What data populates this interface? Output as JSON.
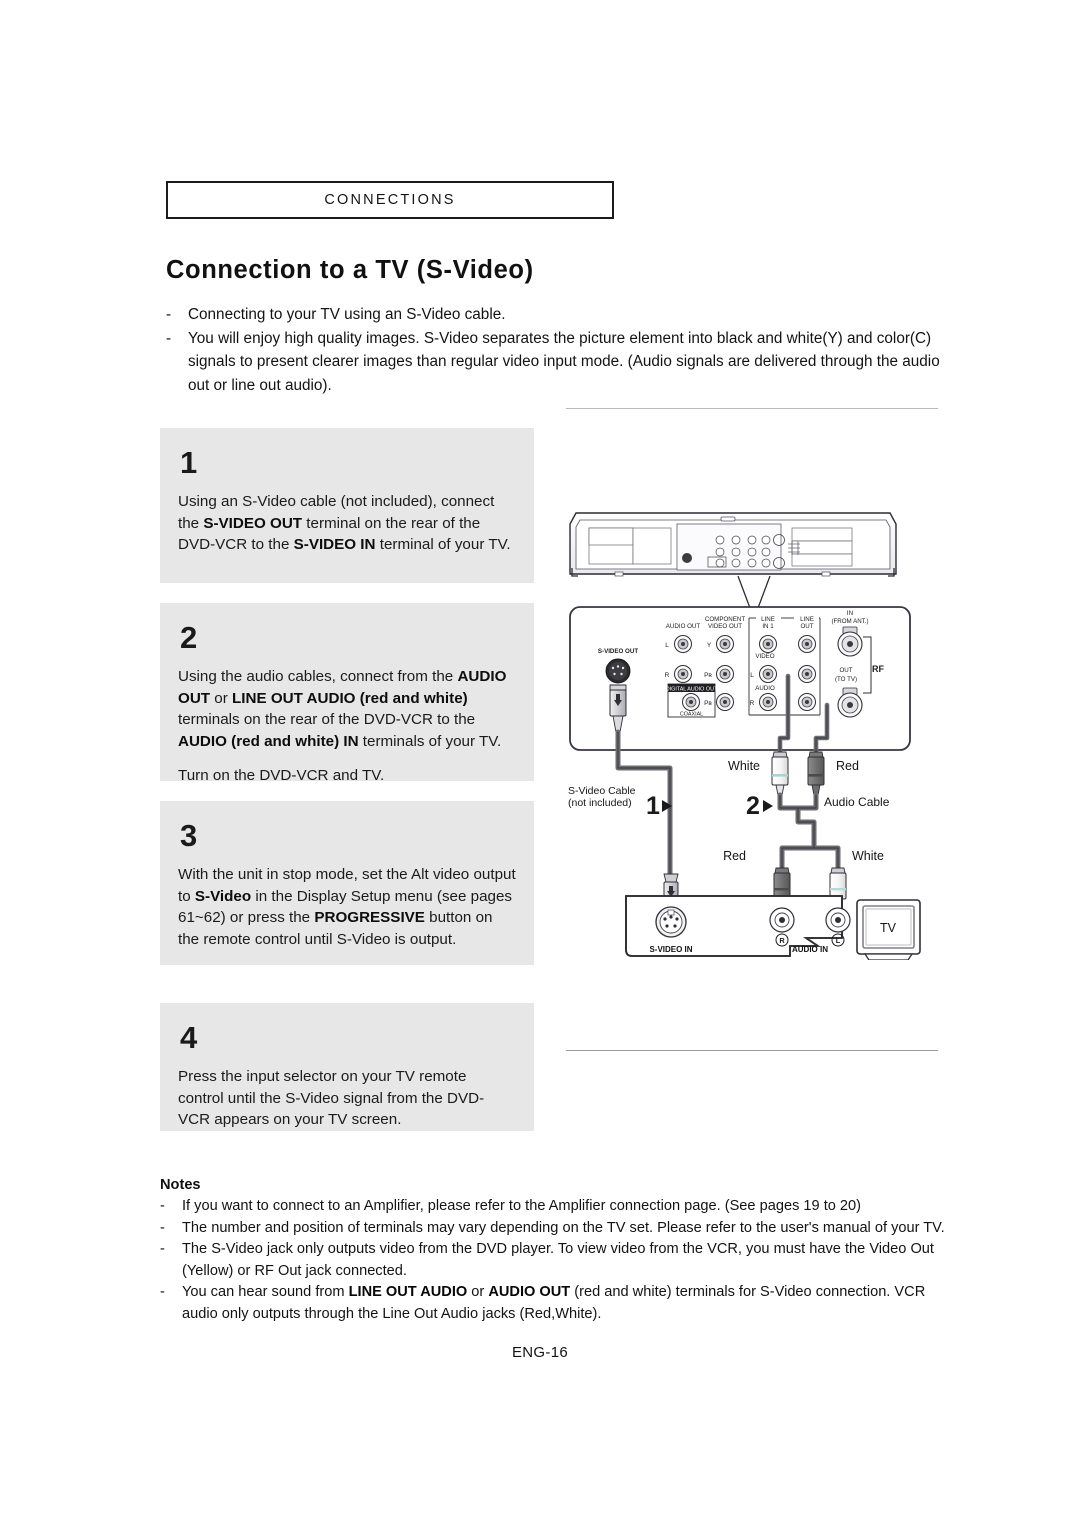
{
  "header": {
    "chapter_label": "CONNECTIONS"
  },
  "title": "Connection to a TV (S-Video)",
  "intro": {
    "dash": "-",
    "bullets": [
      "Connecting to your TV using an S-Video cable.",
      "You will enjoy high quality images. S-Video separates the picture element into black and white(Y) and color(C) signals to present clearer images than regular video input mode. (Audio signals are delivered through the audio out or line out audio)."
    ]
  },
  "steps": [
    {
      "number": "1",
      "paragraph_1_a": "Using an S-Video cable (not included), connect the ",
      "paragraph_1_b": "S-VIDEO OUT",
      "paragraph_1_c": " terminal on the rear of the DVD-VCR to the ",
      "paragraph_1_d": "S-VIDEO IN",
      "paragraph_1_e": " terminal of your TV."
    },
    {
      "number": "2",
      "paragraph_1_a": "Using the audio cables, connect from the ",
      "paragraph_1_b": "AUDIO OUT",
      "paragraph_1_c": " or ",
      "paragraph_1_d": "LINE OUT AUDIO (red and white)",
      "paragraph_1_e": " terminals on the rear of the DVD-VCR to the ",
      "paragraph_1_f": "AUDIO (red and white) IN",
      "paragraph_1_g": " terminals of your TV.",
      "paragraph_2": "Turn on the DVD-VCR and TV."
    },
    {
      "number": "3",
      "paragraph_1_a": "With the unit in stop mode, set the Alt video output to ",
      "paragraph_1_b": "S-Video",
      "paragraph_1_c": " in the Display Setup menu (see pages 61~62) or press the ",
      "paragraph_1_d": "PROGRESSIVE",
      "paragraph_1_e": " button on the remote control until S-Video is output."
    },
    {
      "number": "4",
      "paragraph_1_a": "Press the input selector on your TV remote control until the S-Video signal from the DVD-VCR appears on your TV screen."
    }
  ],
  "diagram": {
    "rear_panel": {
      "svideo_out": "S-VIDEO OUT",
      "audio_out": "AUDIO OUT",
      "audio_out_l": "L",
      "audio_out_r": "R",
      "component_video_out": "COMPONENT\nVIDEO OUT",
      "component_y": "Y",
      "component_pb": "PB",
      "component_pr": "PR",
      "digital_audio_out": "DIGITAL AUDIO OUT",
      "coaxial": "COAXIAL",
      "line_in_1": "LINE\nIN 1",
      "line_out": "LINE\nOUT",
      "video": "VIDEO",
      "audio": "AUDIO",
      "jack_l": "L",
      "jack_r": "R",
      "ant_in": "IN\n(FROM ANT.)",
      "ant_out": "OUT\n(TO TV)",
      "rf": "RF"
    },
    "labels": {
      "plug_white_top": "White",
      "plug_red_top": "Red",
      "svideo_cable": "S-Video Cable",
      "svideo_cable_note": "(not included)",
      "audio_cable": "Audio Cable",
      "marker_1": "1",
      "marker_2": "2",
      "plug_red_bottom": "Red",
      "plug_white_bottom": "White",
      "tv_svideo_in": "S-VIDEO IN",
      "tv_audio_in": "AUDIO IN",
      "tv_jack_r": "R",
      "tv_jack_l": "L",
      "tv": "TV"
    },
    "colors": {
      "cable": "#6b6b72",
      "red_plug": "#6a6a6a",
      "white_plug": "#f2f2f2",
      "panel_outline": "#2a2a32"
    }
  },
  "notes": {
    "title": "Notes",
    "dash": "-",
    "items": [
      {
        "a": "If you want to connect to an Amplifier, please refer to the Amplifier connection page. (See pages 19 to 20)"
      },
      {
        "a": "The number and position of terminals may vary depending on the TV set. Please refer to the user's manual of your TV."
      },
      {
        "a": "The S-Video jack only outputs video from the DVD player. To view video from the VCR, you must have the Video Out (Yellow) or RF Out jack connected."
      },
      {
        "a": "You can hear sound from ",
        "b1": "LINE OUT AUDIO",
        "c": " or ",
        "b2": "AUDIO OUT",
        "d": " (red and white) terminals for S-Video connection. VCR audio only outputs through the Line Out Audio jacks (Red,White)."
      }
    ]
  },
  "footer": {
    "page_label": "ENG-16"
  }
}
